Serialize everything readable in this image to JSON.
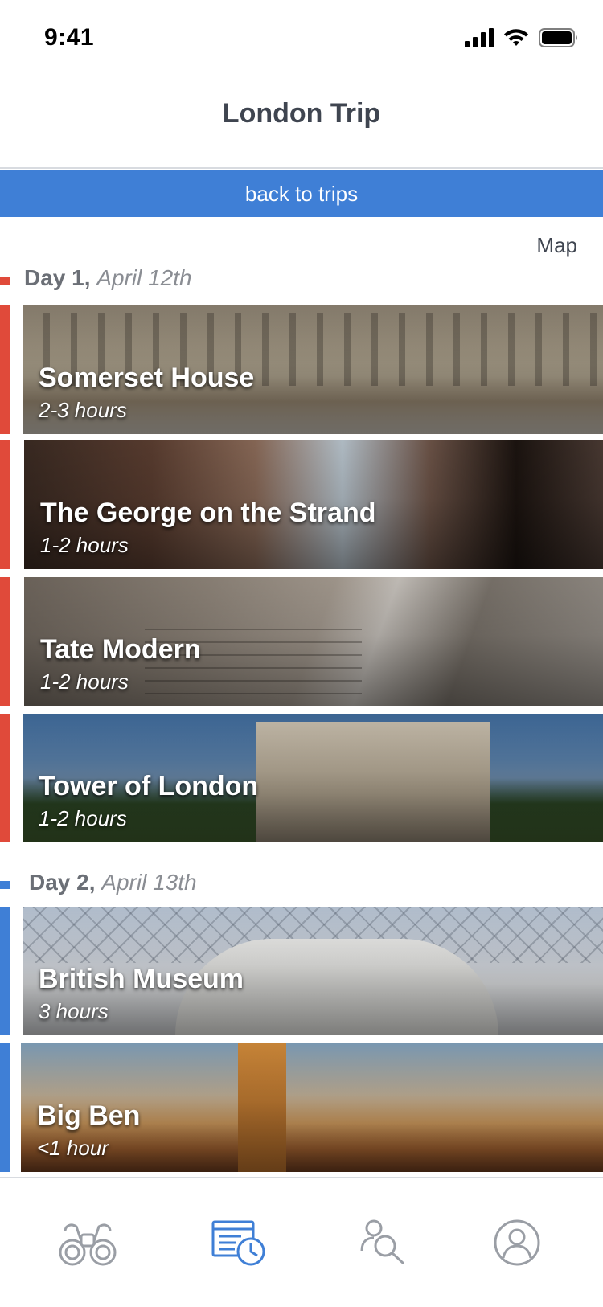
{
  "status": {
    "time": "9:41"
  },
  "header": {
    "title": "London Trip"
  },
  "back": {
    "label": "back to trips"
  },
  "map": {
    "label": "Map"
  },
  "colors": {
    "accent": "#3f7fd6",
    "day1": "#e04a3a",
    "day2": "#3f7fd6",
    "inactive_icon": "#9a9ea5"
  },
  "days": [
    {
      "day": "Day 1,",
      "date": "April 12th",
      "places": [
        {
          "name": "Somerset House",
          "duration": "2-3 hours"
        },
        {
          "name": "The George on the Strand",
          "duration": "1-2 hours"
        },
        {
          "name": "Tate Modern",
          "duration": "1-2 hours"
        },
        {
          "name": "Tower of London",
          "duration": "1-2 hours"
        }
      ]
    },
    {
      "day": "Day 2,",
      "date": "April 13th",
      "places": [
        {
          "name": "British Museum",
          "duration": "3 hours"
        },
        {
          "name": "Big Ben",
          "duration": "<1 hour"
        }
      ]
    }
  ],
  "tabs": [
    {
      "icon": "binoculars-icon"
    },
    {
      "icon": "itinerary-clock-icon",
      "active": true
    },
    {
      "icon": "person-search-icon"
    },
    {
      "icon": "profile-icon"
    }
  ]
}
